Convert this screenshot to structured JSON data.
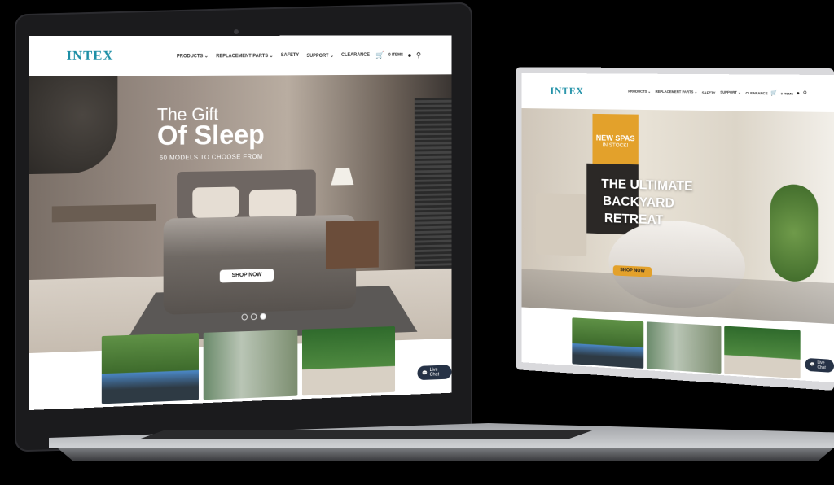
{
  "brand": {
    "logo": "INTEX",
    "accent": "#1d8fa6"
  },
  "nav": {
    "items": [
      "PRODUCTS ⌄",
      "REPLACEMENT PARTS ⌄",
      "SAFETY",
      "SUPPORT ⌄",
      "CLEARANCE"
    ],
    "cart_label": "0 ITEMS",
    "icons": [
      "cart-icon",
      "account-icon",
      "search-icon"
    ]
  },
  "laptop_hero": {
    "line1": "The Gift",
    "line2": "Of Sleep",
    "subtitle": "60 MODELS TO CHOOSE FROM",
    "button": "SHOP NOW"
  },
  "monitor_hero": {
    "badge_line1": "NEW SPAS",
    "badge_line2": "IN STOCK!",
    "line1": "THE ULTIMATE",
    "line2": "BACKYARD",
    "line3": "RETREAT",
    "button": "SHOP NOW"
  },
  "chat": {
    "label": "Live Chat",
    "icon": "chat-icon"
  },
  "colors": {
    "spa_badge": "#e3a12b",
    "dark_button": "#263246"
  }
}
